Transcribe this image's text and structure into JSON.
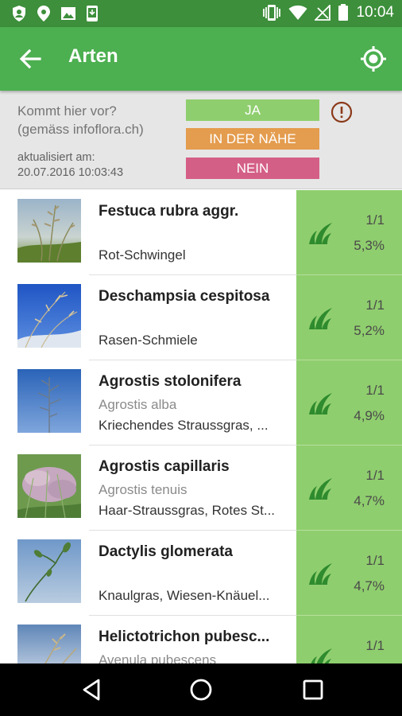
{
  "status_bar": {
    "time": "10:04",
    "left_icons": [
      "shield-icon",
      "location-pin-icon",
      "image-icon",
      "phone-download-icon"
    ],
    "right_icons": [
      "vibrate-icon",
      "wifi-icon",
      "no-signal-icon",
      "battery-icon"
    ]
  },
  "app_bar": {
    "title": "Arten",
    "background": "#4caf50",
    "status_bar_color": "#3d8f3b"
  },
  "info_panel": {
    "question_line1": "Kommt hier vor?",
    "question_line2": "(gemäss infoflora.ch)",
    "updated_label": "aktualisiert am:",
    "updated_value": "20.07.2016 10:03:43",
    "legend": [
      {
        "label": "JA",
        "color": "#8fce6e"
      },
      {
        "label": "IN DER NÄHE",
        "color": "#e49c4e"
      },
      {
        "label": "NEIN",
        "color": "#d45f86"
      }
    ]
  },
  "species": [
    {
      "name": "Festuca rubra aggr.",
      "synonym": "",
      "common": "Rot-Schwingel",
      "count": "1/1",
      "percent": "5,3%"
    },
    {
      "name": "Deschampsia cespitosa",
      "synonym": "",
      "common": "Rasen-Schmiele",
      "count": "1/1",
      "percent": "5,2%"
    },
    {
      "name": "Agrostis stolonifera",
      "synonym": "Agrostis alba",
      "common": "Kriechendes Straussgras, ...",
      "count": "1/1",
      "percent": "4,9%"
    },
    {
      "name": "Agrostis capillaris",
      "synonym": "Agrostis tenuis",
      "common": "Haar-Straussgras, Rotes St...",
      "count": "1/1",
      "percent": "4,7%"
    },
    {
      "name": "Dactylis glomerata",
      "synonym": "",
      "common": "Knaulgras, Wiesen-Knäuel...",
      "count": "1/1",
      "percent": "4,7%"
    },
    {
      "name": "Helictotrichon pubesc...",
      "synonym": "Avenula pubescens",
      "common": "",
      "count": "1/1",
      "percent": ""
    }
  ]
}
